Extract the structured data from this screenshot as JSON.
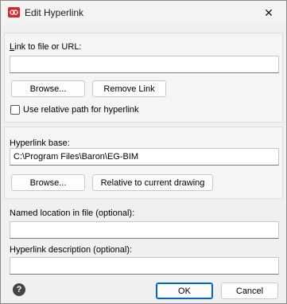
{
  "window": {
    "title": "Edit Hyperlink",
    "close_glyph": "✕"
  },
  "link": {
    "label_prefix": "L",
    "label_rest": "ink to file or URL:",
    "url_value": "",
    "browse_label": "Browse...",
    "remove_label": "Remove Link",
    "relative_checkbox_checked": false,
    "relative_label": "Use relative path for hyperlink"
  },
  "base": {
    "label": "Hyperlink base:",
    "value": "C:\\Program Files\\Baron\\EG-BIM",
    "browse_label": "Browse...",
    "relative_label": "Relative to current drawing"
  },
  "named_location": {
    "label": "Named location in file (optional):",
    "value": ""
  },
  "description": {
    "label": "Hyperlink description (optional):",
    "value": ""
  },
  "footer": {
    "help_glyph": "?",
    "ok_label": "OK",
    "cancel_label": "Cancel"
  },
  "colors": {
    "accent": "#0067c0",
    "app_icon": "#d9262b"
  }
}
